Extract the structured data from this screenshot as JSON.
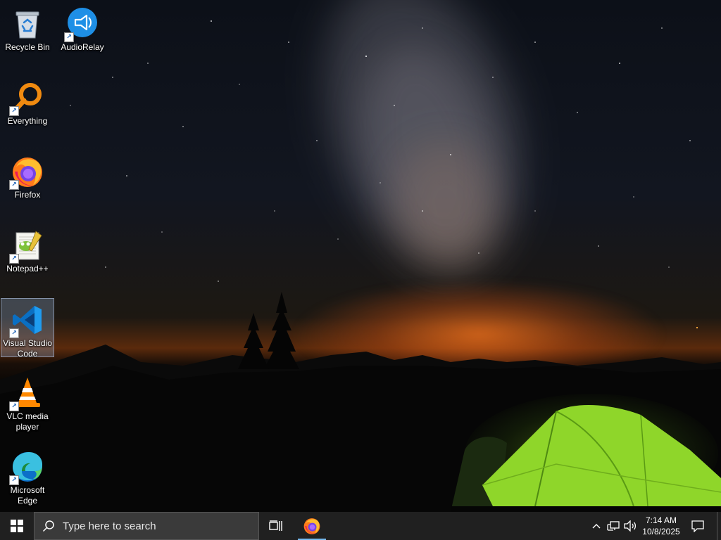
{
  "desktop": {
    "icons": [
      {
        "label": "Recycle Bin",
        "icon": "recycle-bin-icon"
      },
      {
        "label": "AudioRelay",
        "icon": "audiorelay-icon"
      },
      {
        "label": "Everything",
        "icon": "everything-search-icon"
      },
      {
        "label": "Firefox",
        "icon": "firefox-icon"
      },
      {
        "label": "Notepad++",
        "icon": "notepad-plus-plus-icon"
      },
      {
        "label": "Visual Studio Code",
        "icon": "vscode-icon",
        "selected": true
      },
      {
        "label": "VLC media player",
        "icon": "vlc-icon"
      },
      {
        "label": "Microsoft Edge",
        "icon": "edge-icon"
      }
    ]
  },
  "taskbar": {
    "search_placeholder": "Type here to search",
    "pinned": [
      {
        "name": "Firefox",
        "icon": "firefox-icon",
        "active": true
      }
    ],
    "clock": {
      "time": "7:14 AM",
      "date": "10/8/2025"
    },
    "accent_color": "#76b9ed",
    "background_color": "#202020"
  }
}
